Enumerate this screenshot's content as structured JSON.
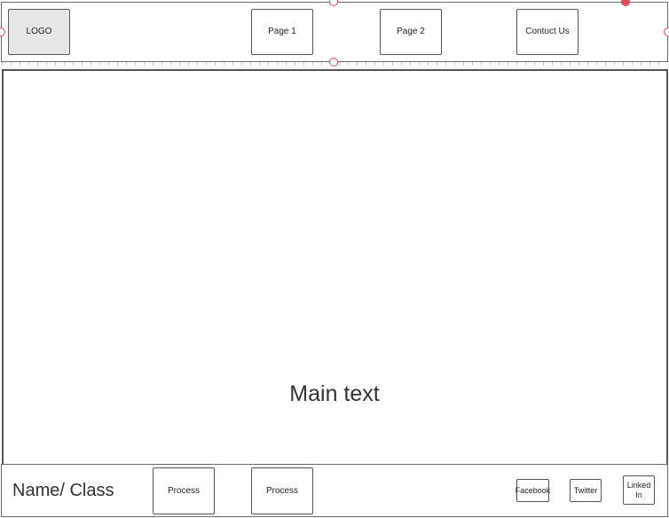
{
  "header": {
    "logo_label": "LOGO",
    "nav": [
      {
        "label": "Page 1"
      },
      {
        "label": "Page 2"
      },
      {
        "label": "Contuct Us"
      }
    ]
  },
  "main": {
    "text": "Main text"
  },
  "footer": {
    "name_label": "Name/ Class",
    "buttons": [
      {
        "label": "Process"
      },
      {
        "label": "Process"
      }
    ],
    "social": [
      {
        "label": "Facebook"
      },
      {
        "label": "Twitter"
      },
      {
        "label": "Linked In"
      }
    ]
  },
  "colors": {
    "selection_handle": "#e04a5a",
    "logo_fill": "#e6e6e6",
    "border": "#555555"
  }
}
